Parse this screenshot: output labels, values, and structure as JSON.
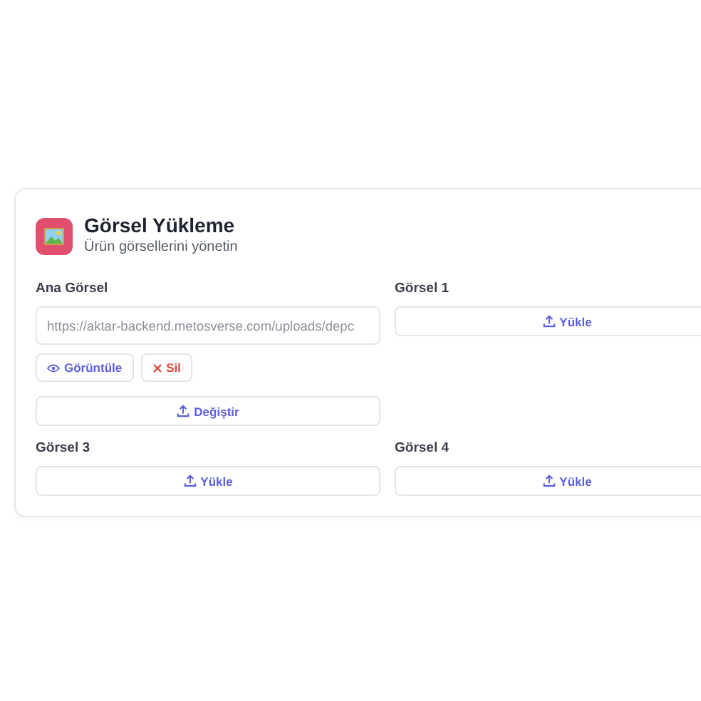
{
  "card": {
    "title": "Görsel Yükleme",
    "subtitle": "Ürün görsellerini yönetin"
  },
  "slots": [
    {
      "kind": "main",
      "label": "Ana Görsel",
      "value": "https://aktar-backend.metosverse.com/uploads/depc",
      "view": "Görüntüle",
      "remove": "Sil",
      "change": "Değiştir"
    },
    {
      "kind": "empty",
      "label": "Görsel 1",
      "upload": "Yükle"
    },
    {
      "kind": "empty",
      "label": "Görsel 3",
      "upload": "Yükle"
    },
    {
      "kind": "empty",
      "label": "Görsel 4",
      "upload": "Yükle"
    }
  ]
}
